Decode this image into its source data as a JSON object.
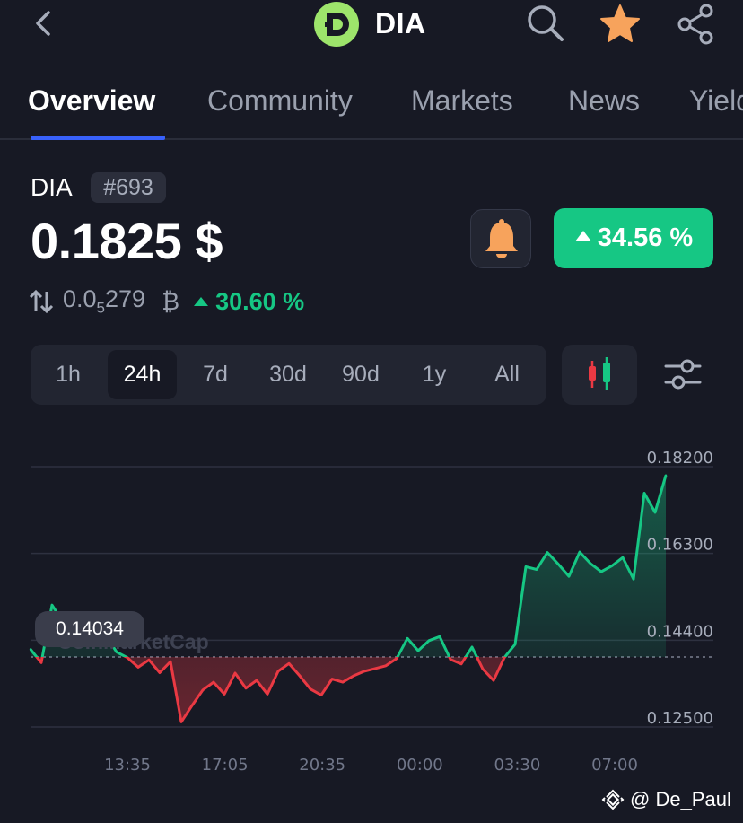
{
  "header": {
    "coin_name": "DIA",
    "icons": [
      "back-arrow-icon",
      "dia-logo-icon",
      "search-icon",
      "star-icon",
      "share-icon"
    ],
    "favorite_color": "#f7a35c"
  },
  "tabs": [
    {
      "label": "Overview",
      "active": true
    },
    {
      "label": "Community",
      "active": false
    },
    {
      "label": "Markets",
      "active": false
    },
    {
      "label": "News",
      "active": false
    },
    {
      "label": "Yield",
      "active": false
    }
  ],
  "price_header": {
    "symbol": "DIA",
    "rank": "#693",
    "price": "0.1825 $",
    "change_24h": "34.56 %",
    "btc_price_prefix": "0.0",
    "btc_price_sub": "5",
    "btc_price_suffix": "279",
    "btc_symbol": "₿",
    "btc_change": "30.60 %",
    "positive_color": "#16c784",
    "negative_color": "#ea3943"
  },
  "timeframes": [
    {
      "label": "1h",
      "active": false
    },
    {
      "label": "24h",
      "active": true
    },
    {
      "label": "7d",
      "active": false
    },
    {
      "label": "30d",
      "active": false
    },
    {
      "label": "90d",
      "active": false
    },
    {
      "label": "1y",
      "active": false
    },
    {
      "label": "All",
      "active": false
    }
  ],
  "chart_data": {
    "type": "line",
    "y_ticks": [
      "0.18200",
      "0.16300",
      "0.14400",
      "0.12500"
    ],
    "x_ticks": [
      "13:35",
      "17:05",
      "20:35",
      "00:00",
      "03:30",
      "07:00"
    ],
    "ylim": [
      0.125,
      0.182
    ],
    "open_price": 0.14034,
    "open_label": "0.14034",
    "watermark": "CoinMarketCap",
    "grid": true,
    "series": [
      {
        "x": [
          "12:30",
          "12:50",
          "13:10",
          "13:30",
          "13:50",
          "14:10",
          "14:30",
          "14:50",
          "15:10",
          "15:30",
          "15:50",
          "16:10",
          "16:30",
          "16:50",
          "17:10",
          "17:30",
          "17:50",
          "18:10",
          "18:30",
          "18:50",
          "19:10",
          "19:30",
          "19:50",
          "20:10",
          "20:30",
          "20:50",
          "21:10",
          "21:30",
          "21:50",
          "22:10",
          "22:30",
          "22:50",
          "23:10",
          "23:30",
          "23:50",
          "00:10",
          "00:30",
          "00:50",
          "01:10",
          "01:30",
          "01:50",
          "02:10",
          "02:30",
          "02:50",
          "03:10",
          "03:30",
          "03:50",
          "04:10",
          "04:30",
          "04:50",
          "05:10",
          "05:30",
          "05:50",
          "06:10",
          "06:30",
          "06:50",
          "07:10",
          "07:30",
          "07:50",
          "08:10"
        ],
        "values": [
          0.142,
          0.1391,
          0.1517,
          0.148,
          0.1428,
          0.1459,
          0.1435,
          0.1451,
          0.1414,
          0.1402,
          0.1381,
          0.1397,
          0.1369,
          0.1393,
          0.1261,
          0.1297,
          0.1331,
          0.1348,
          0.1322,
          0.1368,
          0.1335,
          0.1352,
          0.1322,
          0.1372,
          0.1389,
          0.1362,
          0.1333,
          0.132,
          0.1355,
          0.1348,
          0.1362,
          0.1372,
          0.1378,
          0.1384,
          0.14,
          0.1444,
          0.1417,
          0.1439,
          0.1448,
          0.1398,
          0.1388,
          0.1425,
          0.1377,
          0.1352,
          0.1402,
          0.1431,
          0.1601,
          0.1595,
          0.1632,
          0.1607,
          0.158,
          0.1633,
          0.1608,
          0.159,
          0.1603,
          0.1621,
          0.1574,
          0.1762,
          0.172,
          0.1801
        ]
      }
    ]
  },
  "credit": "@ De_Paul"
}
